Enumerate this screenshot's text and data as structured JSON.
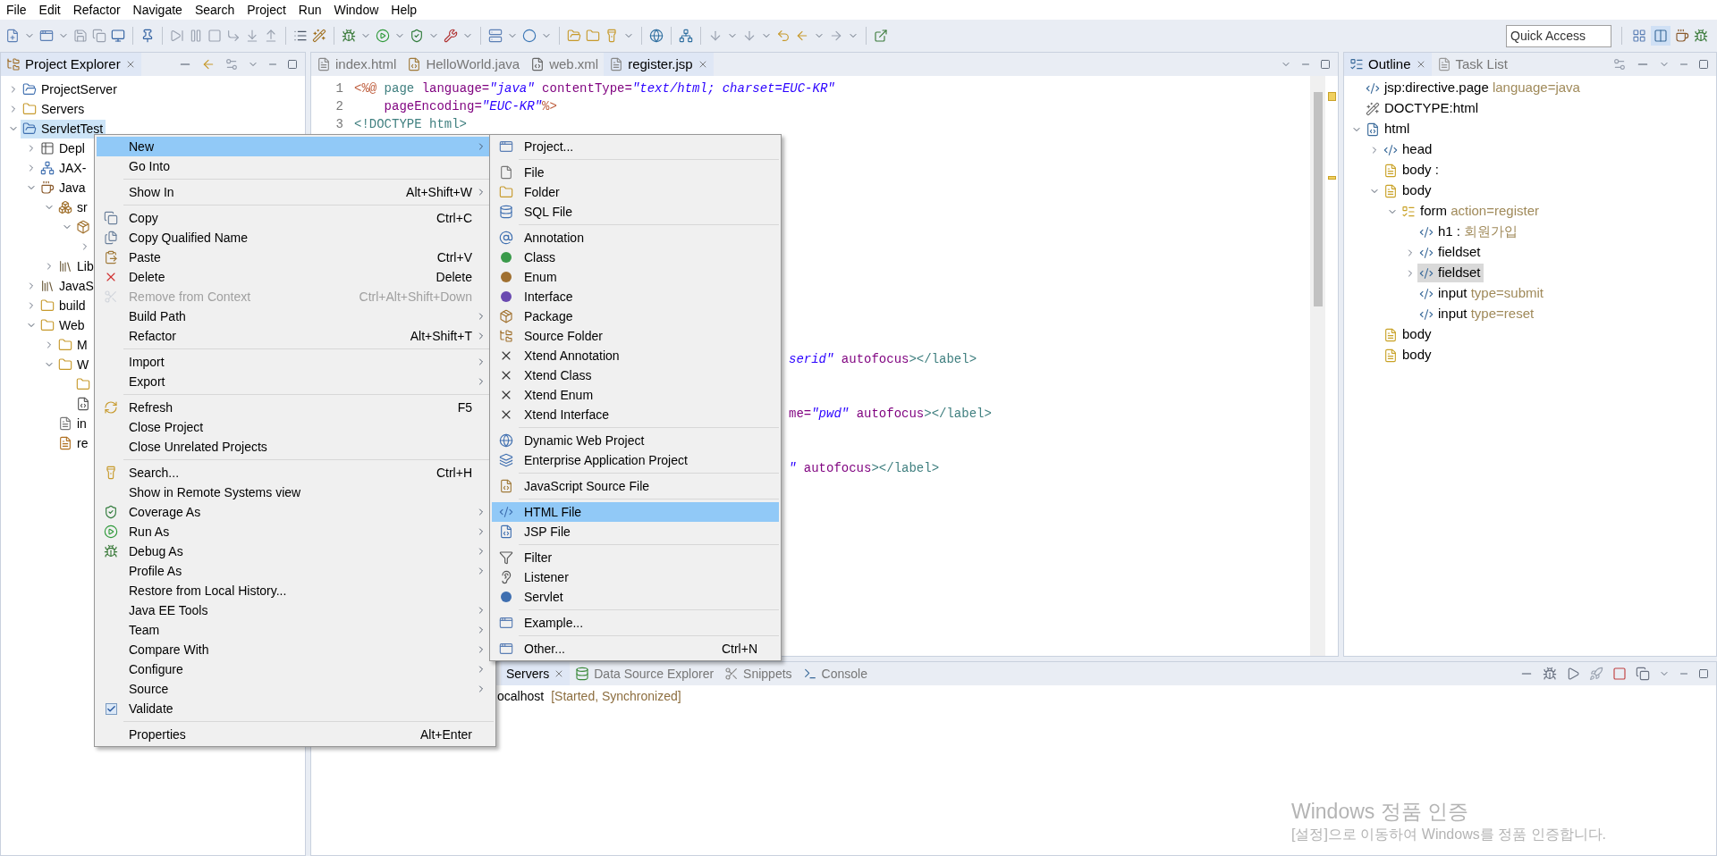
{
  "menu_bar": [
    "File",
    "Edit",
    "Refactor",
    "Navigate",
    "Search",
    "Project",
    "Run",
    "Window",
    "Help"
  ],
  "toolbar": {
    "quick_access": {
      "placeholder": "Quick Access"
    }
  },
  "project_explorer": {
    "tabs": [
      {
        "label": "Project Explorer",
        "selected": true
      }
    ],
    "items": [
      {
        "label": "ProjectServer",
        "kind": "project",
        "expanded": false,
        "selected": false
      },
      {
        "label": "Servers",
        "kind": "folder",
        "expanded": false,
        "selected": false
      },
      {
        "label": "ServletTest",
        "kind": "project",
        "expanded": true,
        "selected": true,
        "children": [
          {
            "label": "Depl",
            "kind": "deploy",
            "expanded": false,
            "selected": false
          },
          {
            "label": "JAX-",
            "kind": "webservice",
            "expanded": false,
            "selected": false
          },
          {
            "label": "Java",
            "kind": "resources",
            "expanded": true,
            "selected": false,
            "children": [
              {
                "label": "sr",
                "kind": "source",
                "expanded": true,
                "selected": false,
                "children": [
                  {
                    "kind": "package",
                    "expanded": true,
                    "selected": false,
                    "children": [
                      {
                        "expanded": false,
                        "selected": false
                      }
                    ]
                  }
                ]
              },
              {
                "label": "Lib",
                "kind": "library",
                "expanded": false,
                "selected": false
              }
            ]
          },
          {
            "label": "JavaS",
            "kind": "library",
            "expanded": false,
            "selected": false
          },
          {
            "label": "build",
            "kind": "folder",
            "expanded": false,
            "selected": false
          },
          {
            "label": "Web",
            "kind": "folder",
            "expanded": true,
            "selected": false,
            "children": [
              {
                "label": "M",
                "kind": "folder",
                "expanded": false,
                "selected": false
              },
              {
                "label": "W",
                "kind": "folder",
                "expanded": true,
                "selected": false,
                "children": [
                  {
                    "kind": "folder",
                    "selected": false
                  },
                  {
                    "kind": "xml",
                    "selected": false
                  }
                ]
              },
              {
                "label": "in",
                "kind": "file",
                "selected": false
              },
              {
                "label": "re",
                "kind": "jsp",
                "selected": false
              }
            ]
          }
        ]
      }
    ]
  },
  "editor": {
    "tabs": [
      {
        "label": "index.html",
        "selected": false
      },
      {
        "label": "HelloWorld.java",
        "selected": false
      },
      {
        "label": "web.xml",
        "selected": false
      },
      {
        "label": "register.jsp",
        "selected": true
      }
    ],
    "lines": [
      {
        "number": "1",
        "tokens": [
          {
            "text": "<%@",
            "kind": "delim"
          },
          {
            "text": " page",
            "kind": "tag"
          },
          {
            "text": " language=",
            "kind": "attr"
          },
          {
            "text": "\"java\"",
            "kind": "value"
          },
          {
            "text": " contentType=",
            "kind": "attr"
          },
          {
            "text": "\"text/html; charset=EUC-KR\"",
            "kind": "value"
          }
        ]
      },
      {
        "number": "2",
        "tokens": [
          {
            "text": "    pageEncoding=",
            "kind": "attr"
          },
          {
            "text": "\"EUC-KR\"",
            "kind": "value"
          },
          {
            "text": "%>",
            "kind": "delim"
          }
        ]
      },
      {
        "number": "3",
        "tokens": [
          {
            "text": "<!DOCTYPE html>",
            "kind": "tag"
          }
        ]
      }
    ],
    "fragments": [
      {
        "tokens": [
          {
            "text": "serid\"",
            "kind": "value"
          },
          {
            "text": " autofocus",
            "kind": "attr"
          },
          {
            "text": "></label>",
            "kind": "tag"
          }
        ]
      },
      {
        "tokens": [
          {
            "text": "me=",
            "kind": "attr"
          },
          {
            "text": "\"pwd\"",
            "kind": "value"
          },
          {
            "text": " autofocus",
            "kind": "attr"
          },
          {
            "text": "></label>",
            "kind": "tag"
          }
        ]
      },
      {
        "tokens": [
          {
            "text": "\"",
            "kind": "value"
          },
          {
            "text": " autofocus",
            "kind": "attr"
          },
          {
            "text": "></label>",
            "kind": "tag"
          }
        ]
      }
    ]
  },
  "outline": {
    "tabs": [
      {
        "label": "Outline",
        "selected": true
      },
      {
        "label": "Task List",
        "selected": false
      }
    ],
    "items": [
      {
        "name": "jsp:directive.page",
        "detail": "language=java",
        "kind": "element",
        "selected": false
      },
      {
        "name": "DOCTYPE:html",
        "kind": "doctype",
        "selected": false
      },
      {
        "name": "html",
        "kind": "document",
        "expanded": true,
        "selected": false,
        "children": [
          {
            "name": "head",
            "kind": "element",
            "expanded": false,
            "selected": false
          },
          {
            "name": "body :",
            "kind": "text",
            "selected": false
          },
          {
            "name": "body",
            "kind": "text",
            "expanded": true,
            "selected": false,
            "children": [
              {
                "name": "form",
                "detail": "action=register",
                "kind": "form",
                "expanded": true,
                "selected": false,
                "children": [
                  {
                    "name": "h1 :",
                    "detail": "회원가입",
                    "kind": "element",
                    "selected": false
                  },
                  {
                    "name": "fieldset",
                    "kind": "element",
                    "expanded": false,
                    "selected": false
                  },
                  {
                    "name": "fieldset",
                    "kind": "element",
                    "expanded": false,
                    "selected": true
                  },
                  {
                    "name": "input",
                    "detail": "type=submit",
                    "kind": "element",
                    "selected": false
                  },
                  {
                    "name": "input",
                    "detail": "type=reset",
                    "kind": "element",
                    "selected": false
                  }
                ]
              }
            ]
          },
          {
            "name": "body",
            "kind": "text",
            "selected": false
          },
          {
            "name": "body",
            "kind": "text",
            "selected": false
          }
        ]
      }
    ]
  },
  "bottom_panel": {
    "tabs": [
      {
        "label": "Servers",
        "selected": true
      },
      {
        "label": "Data Source Explorer",
        "selected": false
      },
      {
        "label": "Snippets",
        "selected": false
      },
      {
        "label": "Console",
        "selected": false
      }
    ],
    "servers": [
      {
        "name": "ocalhost",
        "status": "[Started, Synchronized]"
      }
    ]
  },
  "context_menu": {
    "items": [
      {
        "kind": "item",
        "label": "New",
        "submenu": true,
        "selected": true,
        "disabled": false
      },
      {
        "kind": "item",
        "label": "Go Into",
        "submenu": false,
        "selected": false,
        "disabled": false
      },
      {
        "kind": "separator"
      },
      {
        "kind": "item",
        "label": "Show In",
        "shortcut": "Alt+Shift+W",
        "submenu": true,
        "selected": false,
        "disabled": false
      },
      {
        "kind": "separator"
      },
      {
        "kind": "item",
        "label": "Copy",
        "shortcut": "Ctrl+C",
        "submenu": false,
        "selected": false,
        "disabled": false
      },
      {
        "kind": "item",
        "label": "Copy Qualified Name",
        "submenu": false,
        "selected": false,
        "disabled": false
      },
      {
        "kind": "item",
        "label": "Paste",
        "shortcut": "Ctrl+V",
        "submenu": false,
        "selected": false,
        "disabled": false
      },
      {
        "kind": "item",
        "label": "Delete",
        "shortcut": "Delete",
        "submenu": false,
        "selected": false,
        "disabled": false
      },
      {
        "kind": "item",
        "label": "Remove from Context",
        "shortcut": "Ctrl+Alt+Shift+Down",
        "submenu": false,
        "selected": false,
        "disabled": true
      },
      {
        "kind": "item",
        "label": "Build Path",
        "submenu": true,
        "selected": false,
        "disabled": false
      },
      {
        "kind": "item",
        "label": "Refactor",
        "shortcut": "Alt+Shift+T",
        "submenu": true,
        "selected": false,
        "disabled": false
      },
      {
        "kind": "separator"
      },
      {
        "kind": "item",
        "label": "Import",
        "submenu": true,
        "selected": false,
        "disabled": false
      },
      {
        "kind": "item",
        "label": "Export",
        "submenu": true,
        "selected": false,
        "disabled": false
      },
      {
        "kind": "separator"
      },
      {
        "kind": "item",
        "label": "Refresh",
        "shortcut": "F5",
        "submenu": false,
        "selected": false,
        "disabled": false
      },
      {
        "kind": "item",
        "label": "Close Project",
        "submenu": false,
        "selected": false,
        "disabled": false
      },
      {
        "kind": "item",
        "label": "Close Unrelated Projects",
        "submenu": false,
        "selected": false,
        "disabled": false
      },
      {
        "kind": "separator"
      },
      {
        "kind": "item",
        "label": "Search...",
        "shortcut": "Ctrl+H",
        "submenu": false,
        "selected": false,
        "disabled": false
      },
      {
        "kind": "item",
        "label": "Show in Remote Systems view",
        "submenu": false,
        "selected": false,
        "disabled": false
      },
      {
        "kind": "item",
        "label": "Coverage As",
        "submenu": true,
        "selected": false,
        "disabled": false
      },
      {
        "kind": "item",
        "label": "Run As",
        "submenu": true,
        "selected": false,
        "disabled": false
      },
      {
        "kind": "item",
        "label": "Debug As",
        "submenu": true,
        "selected": false,
        "disabled": false
      },
      {
        "kind": "item",
        "label": "Profile As",
        "submenu": true,
        "selected": false,
        "disabled": false
      },
      {
        "kind": "item",
        "label": "Restore from Local History...",
        "submenu": false,
        "selected": false,
        "disabled": false
      },
      {
        "kind": "item",
        "label": "Java EE Tools",
        "submenu": true,
        "selected": false,
        "disabled": false
      },
      {
        "kind": "item",
        "label": "Team",
        "submenu": true,
        "selected": false,
        "disabled": false
      },
      {
        "kind": "item",
        "label": "Compare With",
        "submenu": true,
        "selected": false,
        "disabled": false
      },
      {
        "kind": "item",
        "label": "Configure",
        "submenu": true,
        "selected": false,
        "disabled": false
      },
      {
        "kind": "item",
        "label": "Source",
        "submenu": true,
        "selected": false,
        "disabled": false
      },
      {
        "kind": "check",
        "label": "Validate",
        "checked": true,
        "submenu": false,
        "selected": false,
        "disabled": false
      },
      {
        "kind": "separator"
      },
      {
        "kind": "item",
        "label": "Properties",
        "shortcut": "Alt+Enter",
        "submenu": false,
        "selected": false,
        "disabled": false
      }
    ]
  },
  "submenu": {
    "items": [
      {
        "kind": "item",
        "label": "Project...",
        "selected": false
      },
      {
        "kind": "separator"
      },
      {
        "kind": "item",
        "label": "File",
        "selected": false
      },
      {
        "kind": "item",
        "label": "Folder",
        "selected": false
      },
      {
        "kind": "item",
        "label": "SQL File",
        "selected": false
      },
      {
        "kind": "separator"
      },
      {
        "kind": "item",
        "label": "Annotation",
        "selected": false
      },
      {
        "kind": "item",
        "label": "Class",
        "selected": false
      },
      {
        "kind": "item",
        "label": "Enum",
        "selected": false
      },
      {
        "kind": "item",
        "label": "Interface",
        "selected": false
      },
      {
        "kind": "item",
        "label": "Package",
        "selected": false
      },
      {
        "kind": "item",
        "label": "Source Folder",
        "selected": false
      },
      {
        "kind": "item",
        "label": "Xtend Annotation",
        "selected": false
      },
      {
        "kind": "item",
        "label": "Xtend Class",
        "selected": false
      },
      {
        "kind": "item",
        "label": "Xtend Enum",
        "selected": false
      },
      {
        "kind": "item",
        "label": "Xtend Interface",
        "selected": false
      },
      {
        "kind": "separator"
      },
      {
        "kind": "item",
        "label": "Dynamic Web Project",
        "selected": false
      },
      {
        "kind": "item",
        "label": "Enterprise Application Project",
        "selected": false
      },
      {
        "kind": "separator"
      },
      {
        "kind": "item",
        "label": "JavaScript Source File",
        "selected": false
      },
      {
        "kind": "separator"
      },
      {
        "kind": "item",
        "label": "HTML File",
        "selected": true
      },
      {
        "kind": "item",
        "label": "JSP File",
        "selected": false
      },
      {
        "kind": "separator"
      },
      {
        "kind": "item",
        "label": "Filter",
        "selected": false
      },
      {
        "kind": "item",
        "label": "Listener",
        "selected": false
      },
      {
        "kind": "item",
        "label": "Servlet",
        "selected": false
      },
      {
        "kind": "separator"
      },
      {
        "kind": "item",
        "label": "Example...",
        "selected": false
      },
      {
        "kind": "separator"
      },
      {
        "kind": "item",
        "label": "Other...",
        "shortcut": "Ctrl+N",
        "selected": false
      }
    ]
  },
  "activation_notice": {
    "title": "Windows 정품 인증",
    "message": "[설정]으로 이동하여 Windows를 정품 인증합니다."
  }
}
